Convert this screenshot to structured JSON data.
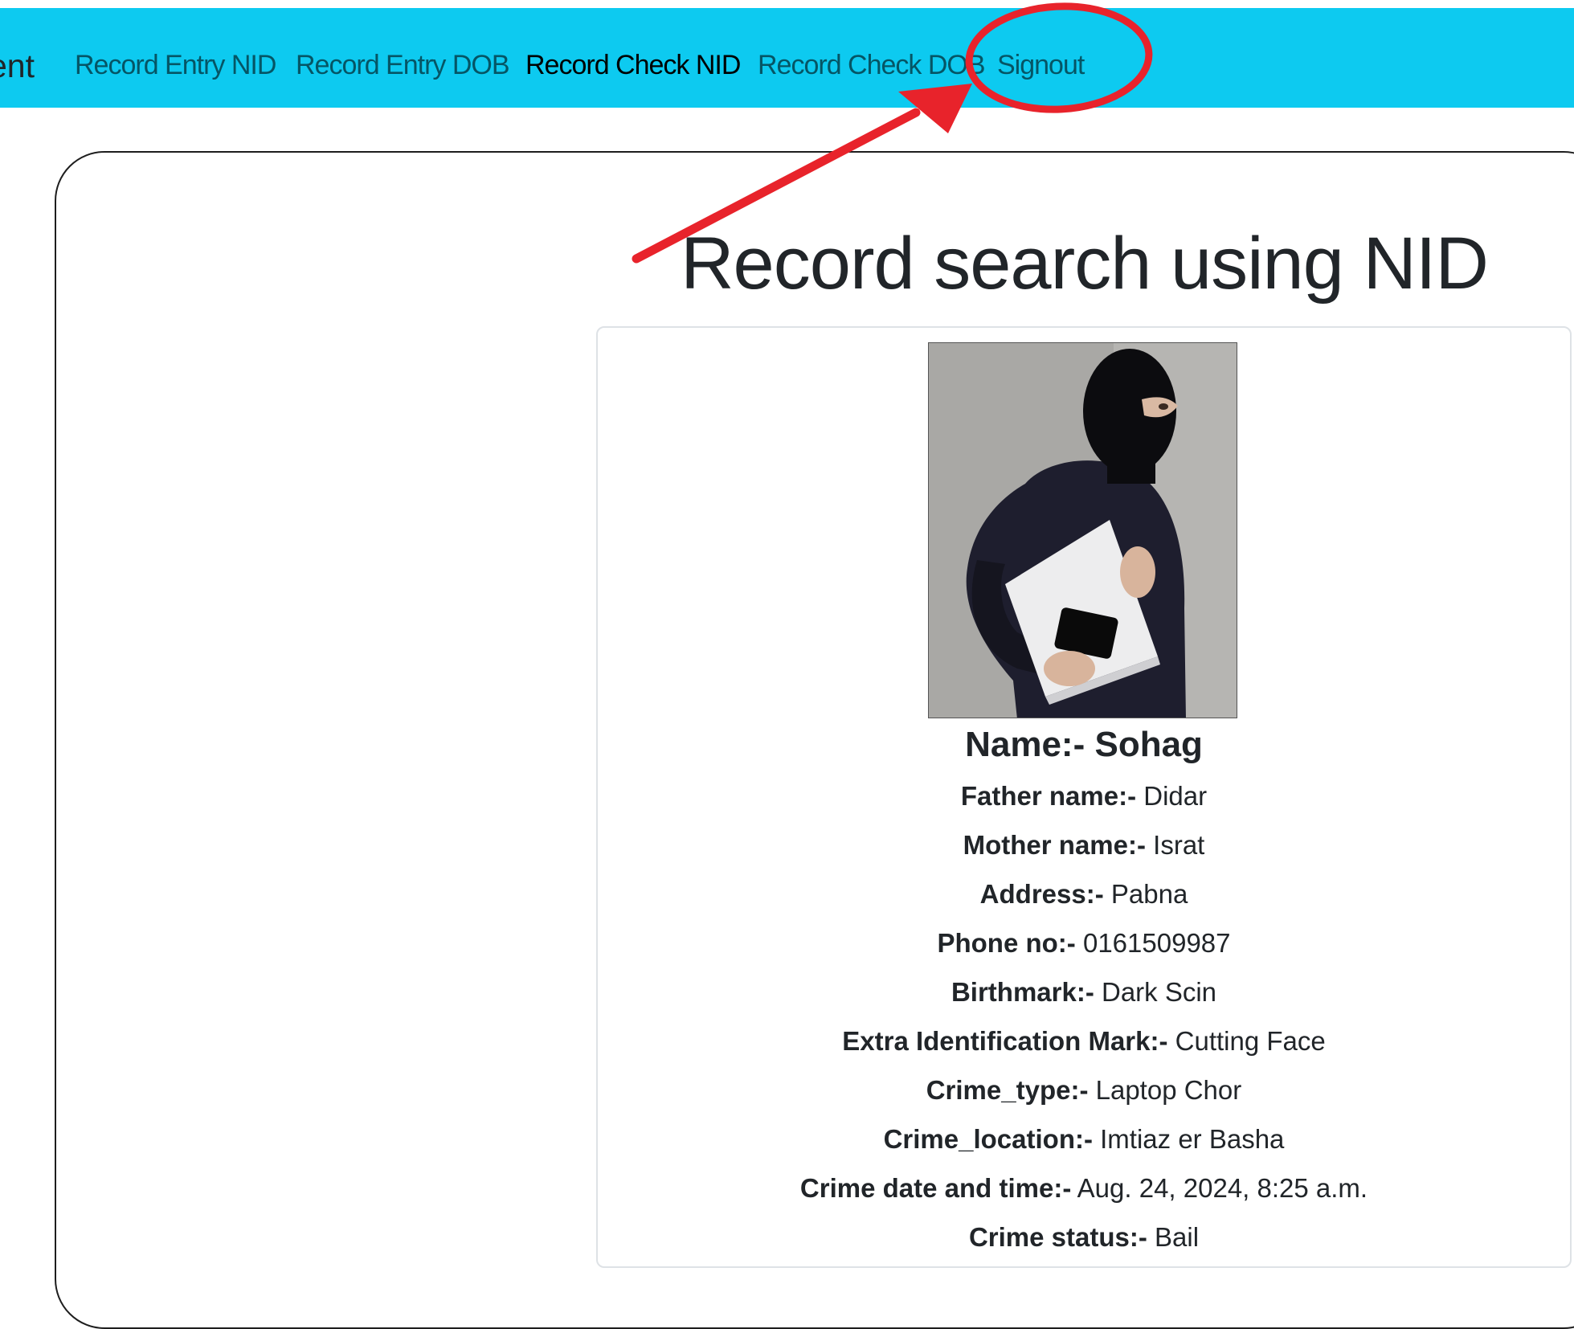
{
  "nav": {
    "brand_partial": "ent",
    "items": [
      {
        "label": "Record Entry NID",
        "active": false
      },
      {
        "label": "Record Entry DOB",
        "active": false
      },
      {
        "label": "Record Check NID",
        "active": true
      },
      {
        "label": "Record Check DOB",
        "active": false
      },
      {
        "label": "Signout",
        "active": false
      }
    ],
    "background_color": "#0dcaf0"
  },
  "annotation": {
    "type": "red circle with arrow",
    "highlighted_item": "Signout",
    "color": "#e8232b"
  },
  "main": {
    "title": "Record search using NID",
    "record": {
      "photo_icon": "masked-person-photo",
      "name_label": "Name:-",
      "name_value": "Sohag",
      "fields": [
        {
          "label": "Father name:-",
          "value": "Didar"
        },
        {
          "label": "Mother name:-",
          "value": "Israt"
        },
        {
          "label": "Address:-",
          "value": "Pabna"
        },
        {
          "label": "Phone no:-",
          "value": "0161509987"
        },
        {
          "label": "Birthmark:-",
          "value": "Dark Scin"
        },
        {
          "label": "Extra Identification Mark:-",
          "value": "Cutting Face"
        },
        {
          "label": "Crime_type:-",
          "value": "Laptop Chor"
        },
        {
          "label": "Crime_location:-",
          "value": "Imtiaz er Basha"
        },
        {
          "label": "Crime date and time:-",
          "value": "Aug. 24, 2024, 8:25 a.m."
        },
        {
          "label": "Crime status:-",
          "value": "Bail"
        }
      ]
    }
  }
}
